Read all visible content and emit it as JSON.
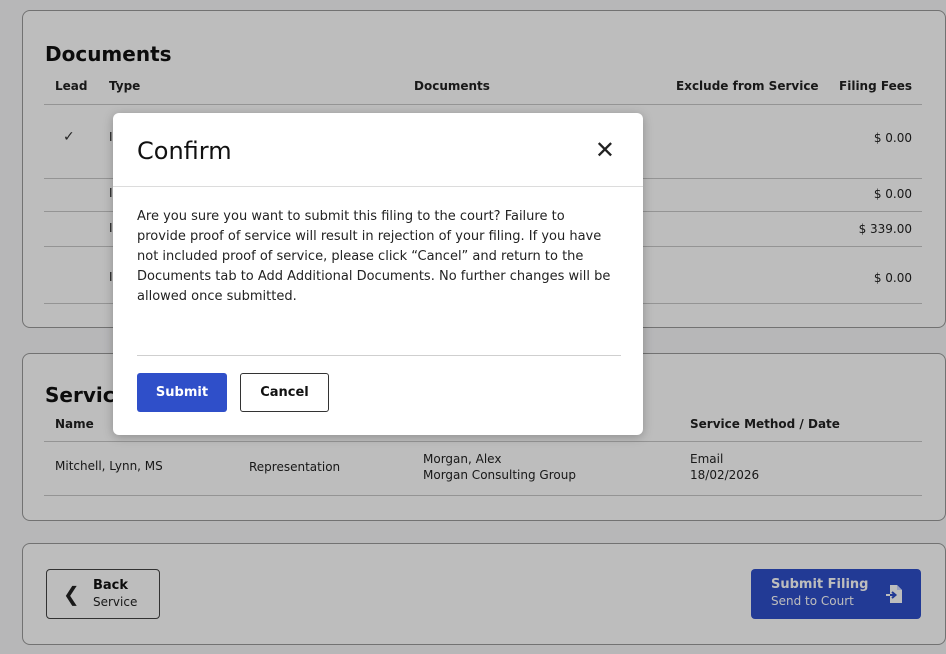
{
  "documents": {
    "title": "Documents",
    "columns": {
      "lead": "Lead",
      "type": "Type",
      "documents": "Documents",
      "exclude": "Exclude from Service",
      "fees": "Filing Fees"
    },
    "rows": [
      {
        "lead": "✓",
        "type": "I",
        "fee": "$ 0.00"
      },
      {
        "lead": "",
        "type": "I",
        "fee": "$ 0.00"
      },
      {
        "lead": "",
        "type": "I",
        "fee": "$ 339.00"
      },
      {
        "lead": "",
        "type": "I",
        "fee": "$ 0.00"
      }
    ]
  },
  "service": {
    "title": "Servic",
    "columns": {
      "name": "Name",
      "method": "Service Method / Date"
    },
    "rows": [
      {
        "name": "Mitchell, Lynn, MS",
        "type": "Representation",
        "party_line1": "Morgan, Alex",
        "party_line2": "Morgan Consulting Group",
        "method": "Email",
        "date": "18/02/2026"
      }
    ]
  },
  "nav": {
    "back_label": "Back",
    "back_sub": "Service",
    "submit_label": "Submit Filing",
    "submit_sub": "Send to Court"
  },
  "modal": {
    "title": "Confirm",
    "close": "✕",
    "body": "Are you sure you want to submit this filing to the court? Failure to provide proof of service will result in rejection of your filing. If you have not included proof of service, please click “Cancel” and return to the Documents tab to Add Additional Documents. No further changes will be allowed once submitted.",
    "submit": "Submit",
    "cancel": "Cancel"
  },
  "colors": {
    "primary": "#2f4fc9",
    "overlay": "rgba(0,0,0,0.26)"
  },
  "icons": {
    "back": "chevron-left-icon",
    "submit": "send-document-icon",
    "close": "close-icon",
    "lead": "checkmark-icon"
  }
}
